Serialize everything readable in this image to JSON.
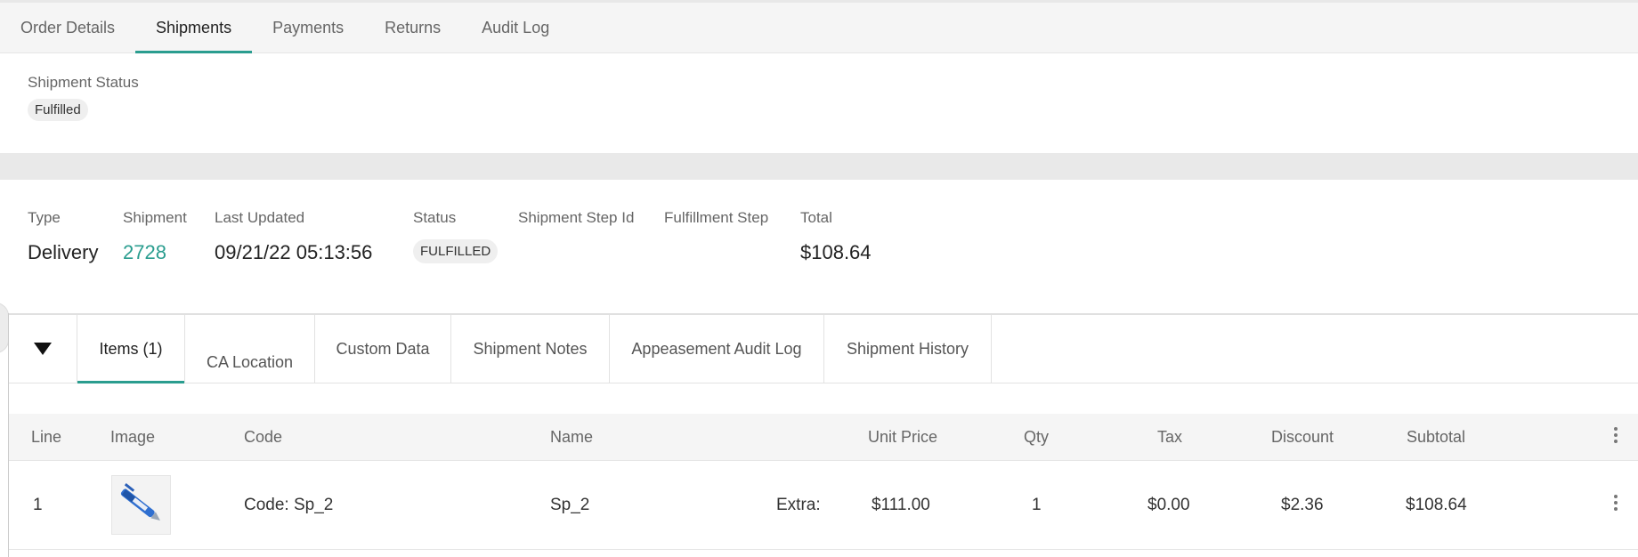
{
  "top_tabs": [
    "Order Details",
    "Shipments",
    "Payments",
    "Returns",
    "Audit Log"
  ],
  "shipment_status": {
    "label": "Shipment Status",
    "value": "Fulfilled"
  },
  "summary": {
    "type_label": "Type",
    "type_value": "Delivery",
    "shipment_label": "Shipment",
    "shipment_value": "2728",
    "last_updated_label": "Last Updated",
    "last_updated_value": "09/21/22 05:13:56",
    "status_label": "Status",
    "status_value": "FULFILLED",
    "step_id_label": "Shipment Step Id",
    "fulfillment_step_label": "Fulfillment Step",
    "total_label": "Total",
    "total_value": "$108.64"
  },
  "inner_tabs": [
    "Items (1)",
    "CA Location",
    "Custom Data",
    "Shipment Notes",
    "Appeasement Audit Log",
    "Shipment History"
  ],
  "table": {
    "headers": [
      "Line",
      "Image",
      "Code",
      "Name",
      "Unit Price",
      "Qty",
      "Tax",
      "Discount",
      "Subtotal"
    ],
    "rows": [
      {
        "line": "1",
        "code": "Code: Sp_2",
        "name": "Sp_2",
        "extra": "Extra:",
        "unit_price": "$111.00",
        "qty": "1",
        "tax": "$0.00",
        "discount": "$2.36",
        "subtotal": "$108.64"
      }
    ]
  },
  "colors": {
    "accent": "#2a9d8f",
    "band": "#e9e9e9"
  },
  "icons": {
    "collapse": "triangle-down-icon",
    "menu": "kebab-icon",
    "product_image": "pen-icon"
  }
}
